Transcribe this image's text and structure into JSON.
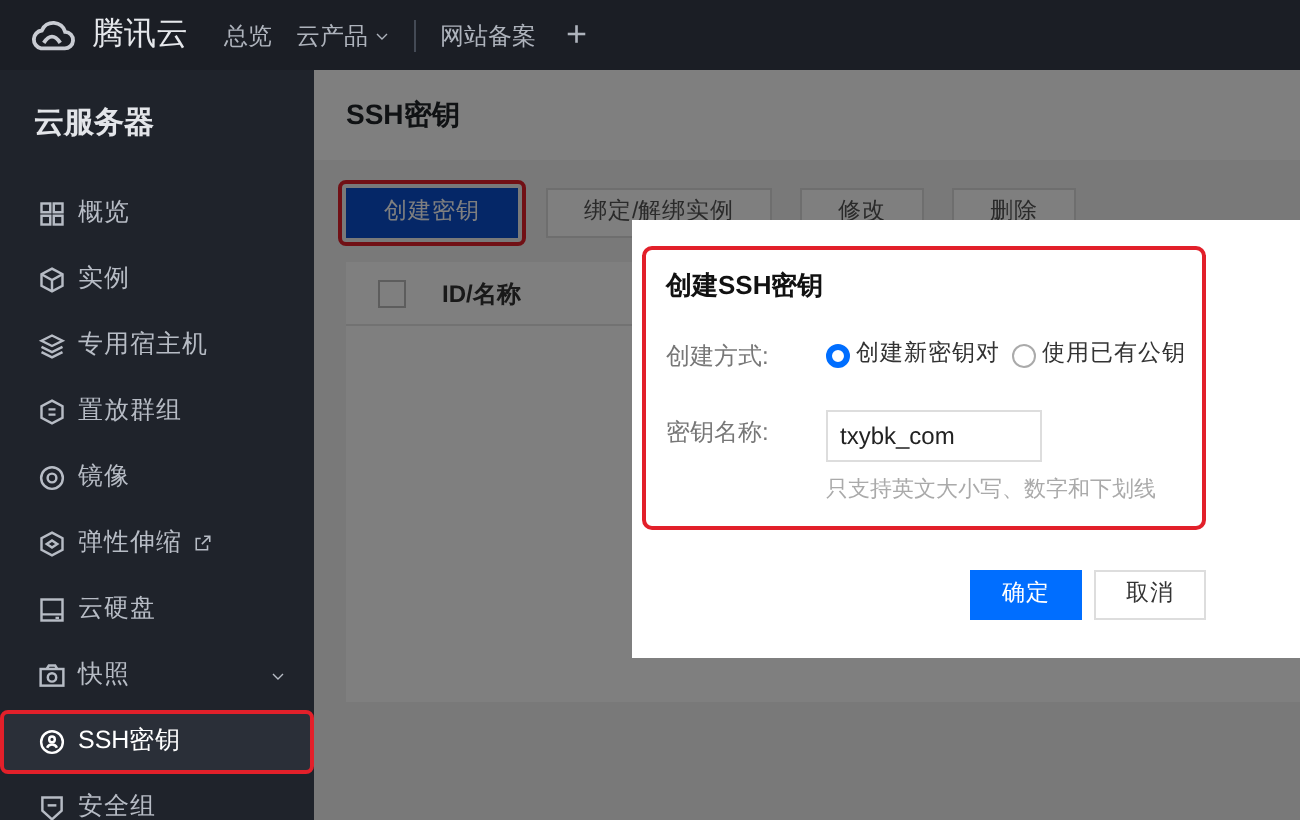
{
  "topbar": {
    "brand": "腾讯云",
    "nav": [
      {
        "label": "总览",
        "kind": "link"
      },
      {
        "label": "云产品",
        "kind": "dropdown"
      },
      {
        "label": "网站备案",
        "kind": "link"
      }
    ],
    "add": "+"
  },
  "sidebar": {
    "title": "云服务器",
    "items": [
      {
        "label": "概览",
        "kind": "plain",
        "selected": false,
        "highlighted": false
      },
      {
        "label": "实例",
        "kind": "plain",
        "selected": false,
        "highlighted": false
      },
      {
        "label": "专用宿主机",
        "kind": "plain",
        "selected": false,
        "highlighted": false
      },
      {
        "label": "置放群组",
        "kind": "plain",
        "selected": false,
        "highlighted": false
      },
      {
        "label": "镜像",
        "kind": "plain",
        "selected": false,
        "highlighted": false
      },
      {
        "label": "弹性伸缩",
        "kind": "external",
        "selected": false,
        "highlighted": false
      },
      {
        "label": "云硬盘",
        "kind": "plain",
        "selected": false,
        "highlighted": false
      },
      {
        "label": "快照",
        "kind": "submenu",
        "selected": false,
        "highlighted": false
      },
      {
        "label": "SSH密钥",
        "kind": "plain",
        "selected": true,
        "highlighted": true
      },
      {
        "label": "安全组",
        "kind": "plain",
        "selected": false,
        "highlighted": false
      }
    ]
  },
  "page_title": "SSH密钥",
  "toolbar": [
    {
      "label": "创建密钥",
      "primary": true,
      "highlighted": true
    },
    {
      "label": "绑定/解绑实例",
      "primary": false,
      "highlighted": false
    },
    {
      "label": "修改",
      "primary": false,
      "highlighted": false
    },
    {
      "label": "删除",
      "primary": false,
      "highlighted": false
    }
  ],
  "table": {
    "select_all_checked": false,
    "columns": [
      "ID/名称"
    ]
  },
  "dialog": {
    "title": "创建SSH密钥",
    "highlighted": true,
    "fields": [
      {
        "kind": "radio",
        "label": "创建方式:",
        "options": [
          {
            "label": "创建新密钥对",
            "selected": true
          },
          {
            "label": "使用已有公钥",
            "selected": false
          }
        ]
      },
      {
        "kind": "text",
        "label": "密钥名称:",
        "value": "txybk_com",
        "help": "只支持英文大小写、数字和下划线"
      }
    ],
    "buttons": [
      {
        "label": "确定",
        "primary": true
      },
      {
        "label": "取消",
        "primary": false
      }
    ]
  }
}
